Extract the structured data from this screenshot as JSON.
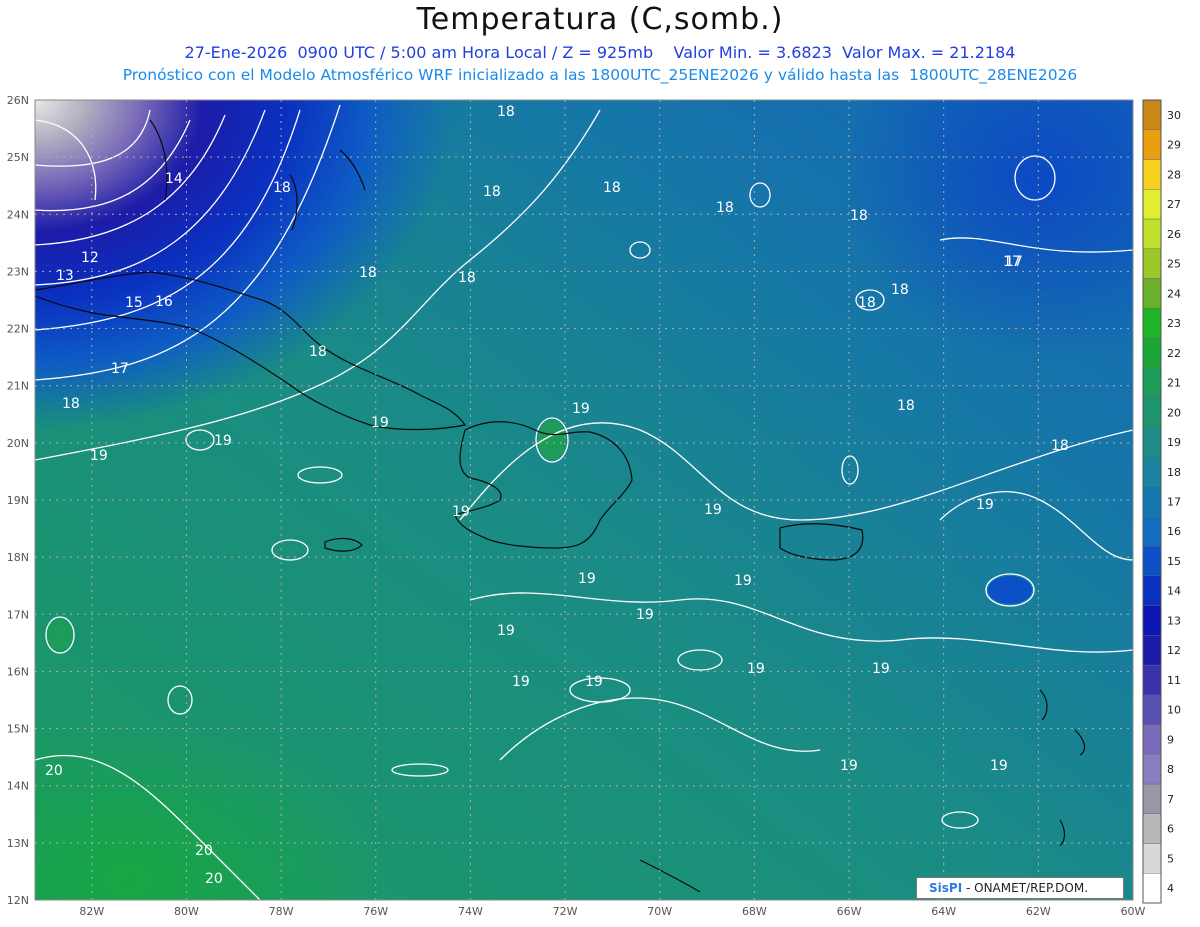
{
  "header": {
    "title": "Temperatura (C,somb.)",
    "line1": "27-Ene-2026  0900 UTC / 5:00 am Hora Local / Z = 925mb    Valor Min. = 3.6823  Valor Max. = 21.2184",
    "line2": "Pronóstico con el Modelo Atmosférico WRF inicializado a las 1800UTC_25ENE2026 y válido hasta las  1800UTC_28ENE2026"
  },
  "map": {
    "lon_range": [
      -83.2,
      -60
    ],
    "lat_range": [
      12,
      26
    ],
    "lat_labels": [
      "12N",
      "13N",
      "14N",
      "15N",
      "16N",
      "17N",
      "18N",
      "19N",
      "20N",
      "21N",
      "22N",
      "23N",
      "24N",
      "25N",
      "26N"
    ],
    "lon_labels": [
      "82W",
      "80W",
      "78W",
      "76W",
      "74W",
      "72W",
      "70W",
      "68W",
      "66W",
      "64W",
      "62W",
      "60W"
    ],
    "contour_labels": [
      "18",
      "18",
      "18",
      "18",
      "18",
      "18",
      "18",
      "17",
      "17",
      "14",
      "12",
      "13",
      "15",
      "16",
      "18",
      "17",
      "18",
      "19",
      "19",
      "19",
      "19",
      "18",
      "18",
      "18",
      "18",
      "18",
      "19",
      "19",
      "19",
      "19",
      "19",
      "19",
      "19",
      "19",
      "19",
      "19",
      "19",
      "20",
      "20",
      "20",
      "19",
      "19"
    ]
  },
  "colorbar": {
    "levels": [
      "4",
      "5",
      "6",
      "7",
      "8",
      "9",
      "10",
      "11",
      "12",
      "13",
      "14",
      "15",
      "16",
      "17",
      "18",
      "19",
      "20",
      "21",
      "22",
      "23",
      "24",
      "25",
      "26",
      "27",
      "28",
      "29",
      "30"
    ],
    "colors": [
      "#ffffff",
      "#d8d8d8",
      "#b8b8b8",
      "#9898a8",
      "#8a7fbe",
      "#7a6ab8",
      "#5a50b4",
      "#3a32aa",
      "#1c1ca8",
      "#0c14b4",
      "#0a30c0",
      "#0c50c8",
      "#126cc0",
      "#1478b0",
      "#1a84a0",
      "#1c8c88",
      "#1c9470",
      "#1c9c58",
      "#18a838",
      "#20b428",
      "#6ab028",
      "#9cc828",
      "#c0e030",
      "#e0ee30",
      "#f8d020",
      "#e8a010",
      "#c88818"
    ]
  },
  "credit": {
    "brand": "SisPI",
    "rest": " - ONAMET/REP.DOM."
  }
}
